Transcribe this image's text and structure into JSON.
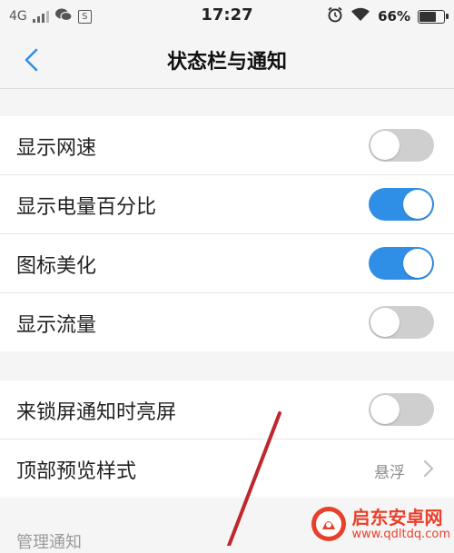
{
  "status_bar": {
    "network": "4G",
    "time": "17:27",
    "battery_percent": "66%",
    "battery_level": 0.66,
    "icons": [
      "signal-icon",
      "wechat-icon",
      "s-app-icon",
      "alarm-icon",
      "wifi-icon",
      "battery-icon"
    ]
  },
  "nav": {
    "title": "状态栏与通知"
  },
  "section1": {
    "items": [
      {
        "label": "显示网速",
        "toggle_on": false
      },
      {
        "label": "显示电量百分比",
        "toggle_on": true
      },
      {
        "label": "图标美化",
        "toggle_on": true
      },
      {
        "label": "显示流量",
        "toggle_on": false
      }
    ]
  },
  "section2": {
    "items": [
      {
        "label": "来锁屏通知时亮屏",
        "toggle_on": false
      },
      {
        "label": "顶部预览样式",
        "value": "悬浮"
      }
    ]
  },
  "manage": {
    "label": "管理通知"
  },
  "watermark": {
    "name": "启东安卓网",
    "url": "www.qdltdq.com"
  },
  "colors": {
    "toggle_on": "#2f8fe6",
    "toggle_off": "#cfcfcf",
    "arrow": "#c0262e",
    "background": "#f5f5f5"
  }
}
